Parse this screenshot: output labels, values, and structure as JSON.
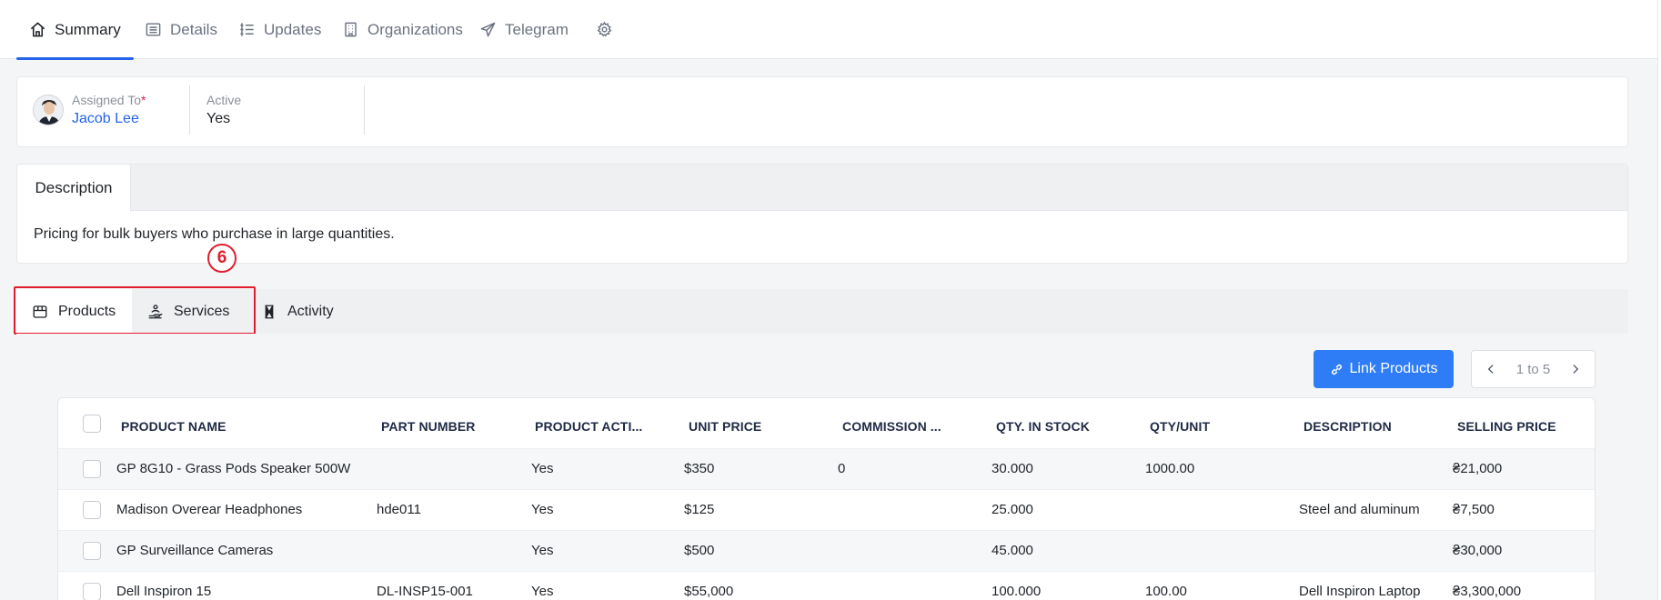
{
  "top_tabs": [
    {
      "label": "Summary",
      "icon": "home-icon"
    },
    {
      "label": "Details",
      "icon": "list-icon"
    },
    {
      "label": "Updates",
      "icon": "timeline-icon"
    },
    {
      "label": "Organizations",
      "icon": "building-icon"
    },
    {
      "label": "Telegram",
      "icon": "send-icon"
    },
    {
      "label": "",
      "icon": "gear-icon"
    }
  ],
  "summary": {
    "assigned_to_label": "Assigned To",
    "required_mark": "*",
    "assigned_to_value": "Jacob Lee",
    "active_label": "Active",
    "active_value": "Yes"
  },
  "description": {
    "tab_label": "Description",
    "text": "Pricing for bulk buyers who purchase in large quantities."
  },
  "related_tabs": [
    {
      "label": "Products",
      "icon": "package-icon"
    },
    {
      "label": "Services",
      "icon": "service-hand-icon"
    },
    {
      "label": "Activity",
      "icon": "hourglass-icon"
    }
  ],
  "annotation": {
    "badge": "6"
  },
  "actions": {
    "link_products_label": "Link Products",
    "pager_text": "1 to 5"
  },
  "table": {
    "columns": [
      "PRODUCT NAME",
      "PART NUMBER",
      "PRODUCT ACTI...",
      "UNIT PRICE",
      "COMMISSION ...",
      "QTY. IN STOCK",
      "QTY/UNIT",
      "DESCRIPTION",
      "SELLING PRICE"
    ],
    "rows": [
      [
        "GP 8G10 - Grass Pods Speaker 500W",
        "",
        "Yes",
        "$350",
        "0",
        "30.000",
        "1000.00",
        "",
        "₴21,000"
      ],
      [
        "Madison Overear Headphones",
        "hde011",
        "Yes",
        "$125",
        "",
        "25.000",
        "",
        "Steel and aluminum",
        "₴7,500"
      ],
      [
        "GP Surveillance Cameras",
        "",
        "Yes",
        "$500",
        "",
        "45.000",
        "",
        "",
        "₴30,000"
      ],
      [
        "Dell Inspiron 15",
        "DL-INSP15-001",
        "Yes",
        "$55,000",
        "",
        "100.000",
        "100.00",
        "Dell Inspiron Laptop",
        "₴3,300,000"
      ]
    ]
  },
  "colors": {
    "accent": "#2563eb",
    "primary_button": "#2f7df6",
    "annotation": "#e11d2e"
  }
}
